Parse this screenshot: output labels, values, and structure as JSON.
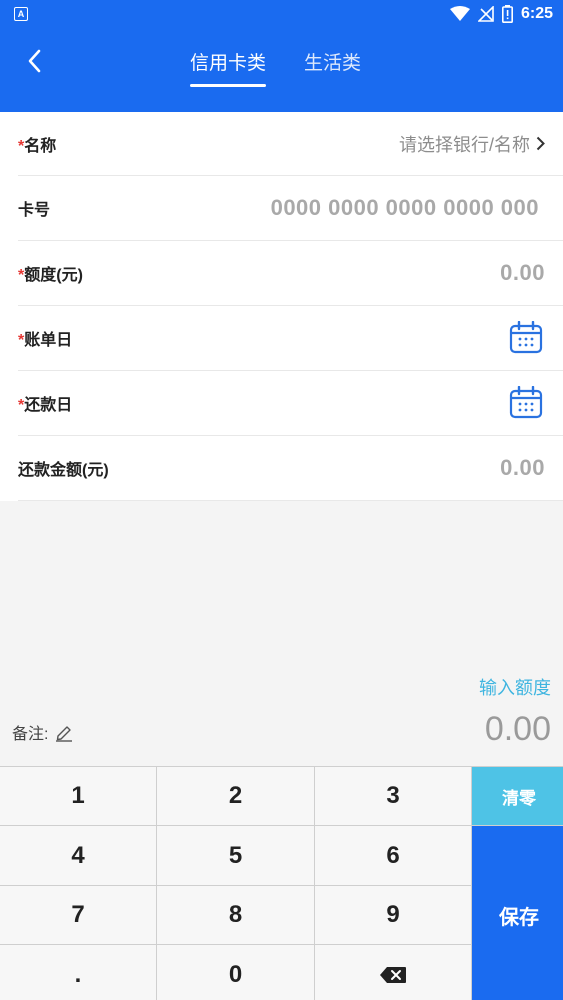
{
  "status_bar": {
    "time": "6:25",
    "left_icon": "A"
  },
  "header": {
    "back_icon": "chevron-left-icon",
    "tabs": [
      {
        "label": "信用卡类",
        "active": true
      },
      {
        "label": "生活类",
        "active": false
      }
    ],
    "color": "#1a6bf0"
  },
  "form": {
    "required_mark": "*",
    "name": {
      "label": "名称",
      "placeholder": "请选择银行/名称"
    },
    "card_number": {
      "label": "卡号",
      "placeholder": "0000 0000 0000 0000 000"
    },
    "limit": {
      "label": "额度(元)",
      "value": "0.00"
    },
    "bill_day": {
      "label": "账单日",
      "icon": "calendar-icon"
    },
    "repay_day": {
      "label": "还款日",
      "icon": "calendar-icon"
    },
    "repay_amount": {
      "label": "还款金额(元)",
      "value": "0.00"
    }
  },
  "amount_entry": {
    "hint": "输入额度",
    "note_label": "备注:",
    "note_icon": "edit-icon",
    "display": "0.00",
    "hint_color": "#3fb5e0"
  },
  "keypad": {
    "keys": [
      "1",
      "2",
      "3",
      "4",
      "5",
      "6",
      "7",
      "8",
      "9",
      ".",
      "0"
    ],
    "backspace_icon": "backspace-icon",
    "clear_label": "清零",
    "save_label": "保存",
    "clear_color": "#4ec3e6",
    "save_color": "#1a6bf0"
  }
}
